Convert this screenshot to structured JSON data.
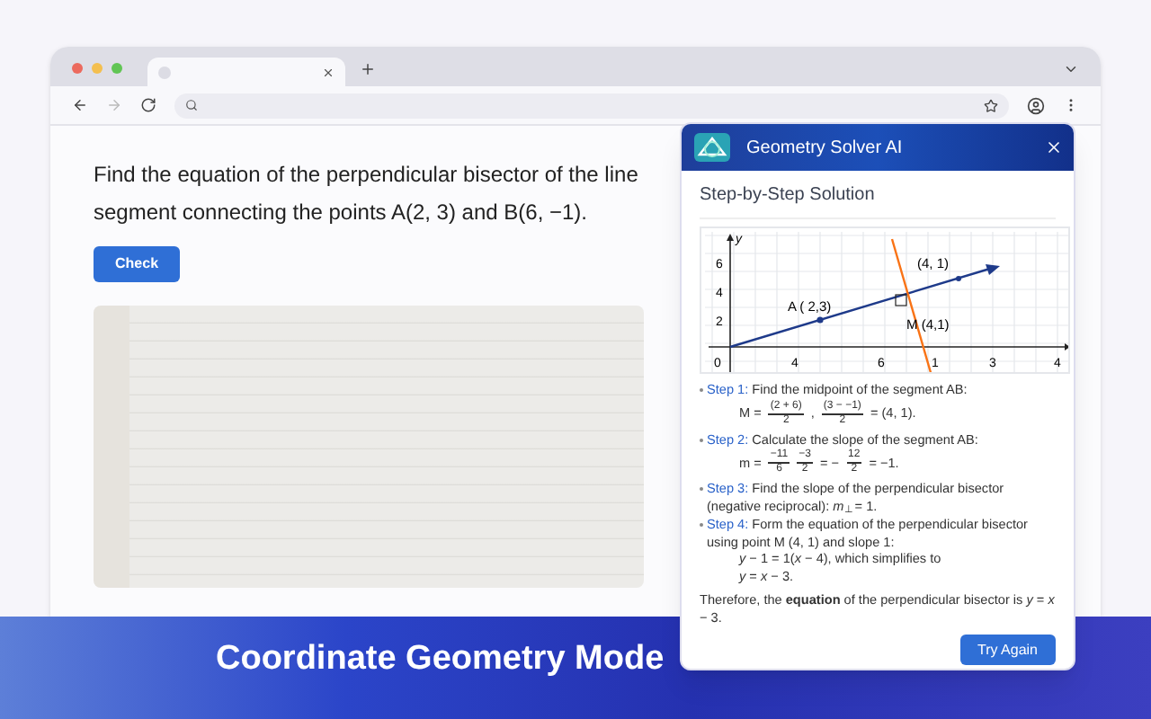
{
  "browser": {
    "tabs": [
      {
        "selected": true
      }
    ]
  },
  "question": {
    "text": "Find the equation of the perpendicular bisector of the line segment connecting the points A(2, 3) and B(6, −1).",
    "button": "Check"
  },
  "panel": {
    "title": "Geometry Solver AI",
    "heading": "Step-by-Step Solution",
    "graph": {
      "y_axis_label": "y",
      "y_ticks": [
        "6",
        "4",
        "2"
      ],
      "x_ticks": [
        "0",
        "4",
        "6",
        "1",
        "3",
        "4"
      ],
      "point_labels": [
        "A ( 2,3)",
        "(4, 1)",
        "M (4,1)"
      ]
    },
    "steps": [
      {
        "label": "Step 1:",
        "text": "Find the midpoint of the segment AB:",
        "math": [
          {
            "kind": "text",
            "text": "M ="
          },
          {
            "kind": "frac",
            "num": "(2 + 6)",
            "den": "2"
          },
          {
            "kind": "text",
            "text": ","
          },
          {
            "kind": "frac",
            "num": "(3 − −1)",
            "den": "2"
          },
          {
            "kind": "text",
            "text": "= (4, 1)."
          }
        ]
      },
      {
        "label": "Step 2:",
        "text": "Calculate the slope of the segment AB:",
        "math": [
          {
            "kind": "text",
            "text": "m ="
          },
          {
            "kind": "frac",
            "num": "−11",
            "den": "6"
          },
          {
            "kind": "frac",
            "num": "−3",
            "den": "2"
          },
          {
            "kind": "text",
            "text": "= −"
          },
          {
            "kind": "frac",
            "num": "12",
            "den": "2"
          },
          {
            "kind": "text",
            "text": "= −1."
          }
        ]
      },
      {
        "label": "Step 3:",
        "text": "Find the slope of the perpendicular bisector (negative reciprocal): *m*$_{⊥}$ = 1."
      },
      {
        "label": "Step 4:",
        "text": "Form the equation of the perpendicular bisector using point M (4, 1) and slope 1:",
        "lines": [
          "*y* − 1 = 1(*x* − 4),  which simplifies to",
          "*y* = *x* − 3."
        ]
      }
    ],
    "conclusion": "Therefore, the **equation** of the perpendicular bisector is *y* = *x* − 3.",
    "button": "Try Again"
  },
  "banner": {
    "title": "Coordinate Geometry Mode"
  }
}
